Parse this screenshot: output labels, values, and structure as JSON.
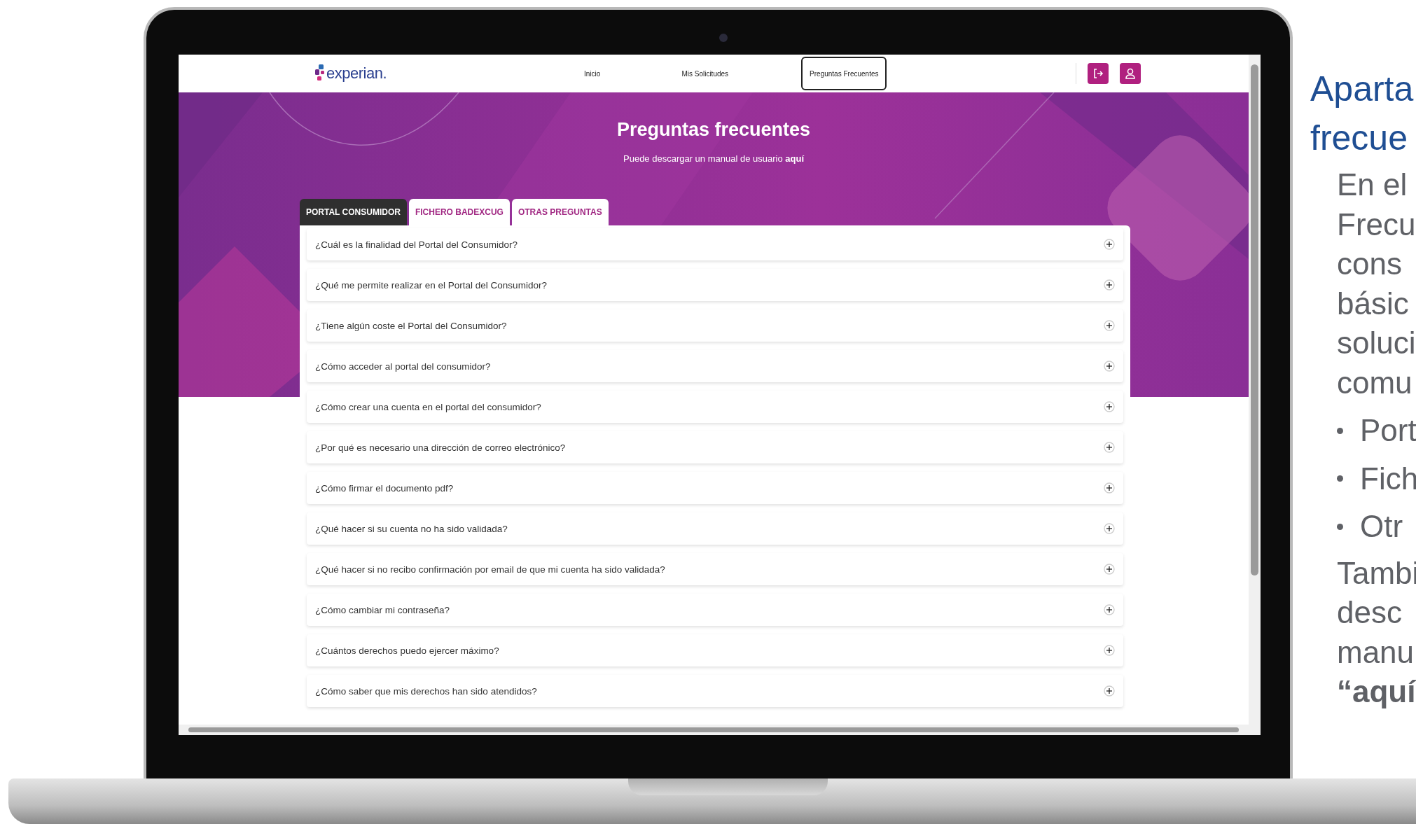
{
  "header": {
    "logo": "experian.",
    "nav": [
      {
        "label": "Inicio",
        "selected": false
      },
      {
        "label": "Mis Solicitudes",
        "selected": false
      },
      {
        "label": "Preguntas Frecuentes",
        "selected": true
      }
    ]
  },
  "hero": {
    "title": "Preguntas frecuentes",
    "subtitle": "Puede descargar un manual de usuario **aquí**"
  },
  "tabs": [
    {
      "label": "PORTAL CONSUMIDOR",
      "selected": true
    },
    {
      "label": "FICHERO BADEXCUG",
      "selected": false
    },
    {
      "label": "OTRAS PREGUNTAS",
      "selected": false
    }
  ],
  "faq": [
    {
      "question": "¿Cuál es la finalidad del Portal del Consumidor?",
      "expanded": false
    },
    {
      "question": "¿Qué me permite realizar en el Portal del Consumidor?",
      "expanded": false
    },
    {
      "question": "¿Tiene algún coste el Portal del Consumidor?",
      "expanded": false
    },
    {
      "question": "¿Cómo acceder al portal del consumidor?",
      "expanded": false
    },
    {
      "question": "¿Cómo crear una cuenta en el portal del consumidor?",
      "expanded": false
    },
    {
      "question": "¿Por qué es necesario una dirección de correo electrónico?",
      "expanded": false
    },
    {
      "question": "¿Cómo firmar el documento pdf?",
      "expanded": false
    },
    {
      "question": "¿Qué hacer si su cuenta no ha sido validada?",
      "expanded": false
    },
    {
      "question": "¿Qué hacer si no recibo confirmación por email de que mi cuenta ha sido validada?",
      "expanded": false
    },
    {
      "question": "¿Cómo cambiar mi contraseña?",
      "expanded": false
    },
    {
      "question": "¿Cuántos derechos puedo ejercer máximo?",
      "expanded": false
    },
    {
      "question": "¿Cómo saber que mis derechos han sido atendidos?",
      "expanded": false
    }
  ],
  "slide": {
    "title_lines": [
      "Aparta",
      "frecue"
    ],
    "paragraph_lines": [
      "En el",
      "Frecu",
      "cons",
      "básic",
      "soluci",
      "comu"
    ],
    "bullets": [
      "Port",
      "Fich",
      "Otr"
    ],
    "closing_lines": [
      {
        "text": "Tambi",
        "bold": false
      },
      {
        "text": "desc",
        "bold": false
      },
      {
        "text": "manu",
        "bold": false
      },
      {
        "text": "“aquí",
        "bold": true
      }
    ]
  }
}
